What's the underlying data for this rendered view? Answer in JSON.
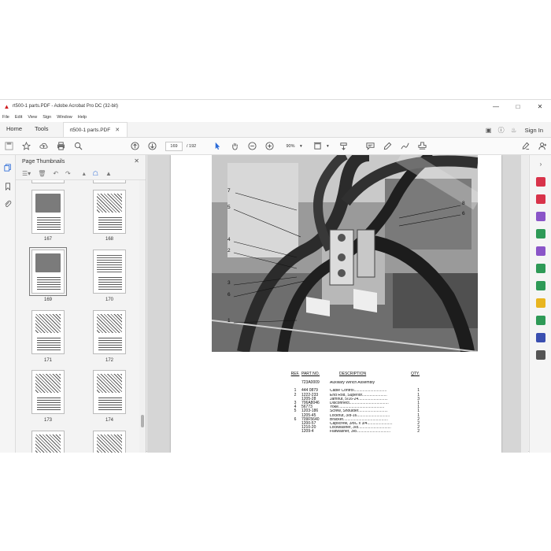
{
  "window": {
    "title": "rt500-1 parts.PDF - Adobe Acrobat Pro DC (32-bit)"
  },
  "menu": [
    "File",
    "Edit",
    "View",
    "Sign",
    "Window",
    "Help"
  ],
  "tabs": {
    "home": "Home",
    "tools": "Tools",
    "document": "rt500-1 parts.PDF",
    "sign_in": "Sign In"
  },
  "toolbar": {
    "current_page": "169",
    "total_pages": "/ 192",
    "zoom": "90%"
  },
  "panel": {
    "title": "Page Thumbnails",
    "thumbnails": [
      {
        "label": "167",
        "kind": "photo"
      },
      {
        "label": "168",
        "kind": "diagram"
      },
      {
        "label": "169",
        "kind": "photo",
        "selected": true
      },
      {
        "label": "170",
        "kind": "diagram"
      },
      {
        "label": "171",
        "kind": "diagram"
      },
      {
        "label": "172",
        "kind": "diagram"
      },
      {
        "label": "173",
        "kind": "diagram"
      },
      {
        "label": "174",
        "kind": "diagram"
      }
    ]
  },
  "figure": {
    "callouts": [
      "7",
      "5",
      "4",
      "2",
      "3",
      "6",
      "1",
      "8",
      "6"
    ]
  },
  "parts_list": {
    "headers": {
      "ref": "REF.",
      "part": "PART NO.",
      "desc": "DESCRIPTION",
      "qty": "QTY."
    },
    "rows": [
      {
        "ref": "",
        "part": "723A0009",
        "desc": "Auxiliary Winch Assembly",
        "qty": ""
      },
      {
        "ref": "",
        "part": "",
        "desc": "",
        "qty": ""
      },
      {
        "ref": "1",
        "part": "444 0879",
        "desc": "Cable Control..............................",
        "qty": "1"
      },
      {
        "ref": "2",
        "part": "1222-233",
        "desc": "End Rod, Superior.......................",
        "qty": "1"
      },
      {
        "ref": "",
        "part": "1205-28",
        "desc": "Jamnut, 5/16-24...........................",
        "qty": "3"
      },
      {
        "ref": "3",
        "part": "706A8046",
        "desc": "Disconnect....................................",
        "qty": "1"
      },
      {
        "ref": "4",
        "part": "56773",
        "desc": "Yoke..........................................",
        "qty": "1"
      },
      {
        "ref": "5",
        "part": "1203-186",
        "desc": "Screw, Shoulder...........................",
        "qty": "1"
      },
      {
        "ref": "",
        "part": "1205-45",
        "desc": "Locknut, 3/8-16..............................",
        "qty": "1"
      },
      {
        "ref": "6",
        "part": "709F5640",
        "desc": "Bracket.........................................",
        "qty": "2"
      },
      {
        "ref": "",
        "part": "1200-57",
        "desc": "Capscrew, 3/8C x 3/4.......................",
        "qty": "2"
      },
      {
        "ref": "",
        "part": "1210-20",
        "desc": "Lockwasher, 3/8..............................",
        "qty": "2"
      },
      {
        "ref": "",
        "part": "1209-4",
        "desc": "Flatwasher, 3/8...............................",
        "qty": "2"
      }
    ]
  },
  "colors": {
    "acrobat_red": "#d01c1f",
    "tool_blue": "#2a6ad8",
    "tool_red": "#d8334a",
    "tool_purple": "#8a55c8",
    "tool_green": "#2e9a57",
    "tool_yellow": "#e8b520",
    "tool_navy": "#3a4fb0"
  },
  "icons": {
    "left_rail": [
      "thumbnails-icon",
      "bookmark-icon",
      "attachment-icon"
    ],
    "right_rail": [
      "export-pdf-icon",
      "create-pdf-icon",
      "combine-files-icon",
      "organize-pages-icon",
      "edit-pdf-icon",
      "export-icon",
      "send-for-review-icon",
      "comment-icon",
      "scan-icon",
      "protect-icon",
      "more-tools-icon"
    ]
  }
}
